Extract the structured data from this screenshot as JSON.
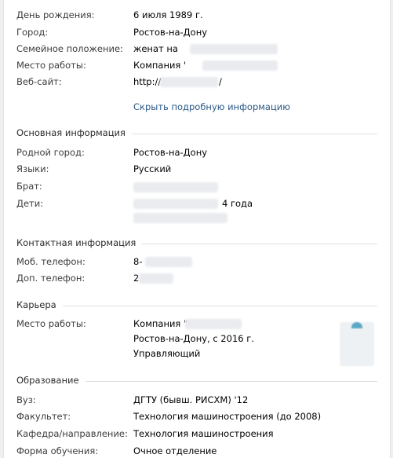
{
  "profile_top": [
    {
      "label": "День рождения:",
      "value": "6 июля 1989 г."
    },
    {
      "label": "Город:",
      "value": "Ростов-на-Дону"
    },
    {
      "label": "Семейное положение:",
      "value": "женат на"
    },
    {
      "label": "Место работы:",
      "value": "Компания '"
    },
    {
      "label": "Веб-сайт:",
      "value": "http://",
      "suffix": "/"
    }
  ],
  "toggle_details": "Скрыть подробную информацию",
  "sections": {
    "basic": {
      "title": "Основная информация",
      "rows": [
        {
          "label": "Родной город:",
          "value": "Ростов-на-Дону"
        },
        {
          "label": "Языки:",
          "value": "Русский"
        },
        {
          "label": "Брат:",
          "value": ""
        },
        {
          "label": "Дети:",
          "value": "",
          "value_suffix": "4 года"
        }
      ]
    },
    "contacts": {
      "title": "Контактная информация",
      "rows": [
        {
          "label": "Моб. телефон:",
          "value": "8-"
        },
        {
          "label": "Доп. телефон:",
          "value": "2"
        }
      ]
    },
    "career": {
      "title": "Карьера",
      "rows": [
        {
          "label": "Место работы:",
          "lines": [
            "Компания \"",
            "Ростов-на-Дону, с 2016 г.",
            "Управляющий"
          ]
        }
      ]
    },
    "education": {
      "title": "Образование",
      "rows": [
        {
          "label": "Вуз:",
          "value": "ДГТУ (бывш. РИСХМ) '12"
        },
        {
          "label": "Факультет:",
          "value": "Технология машиностроения (до 2008)"
        },
        {
          "label": "Кафедра/направление:",
          "value": "Технология машиностроения"
        },
        {
          "label": "Форма обучения:",
          "value": "Очное отделение"
        }
      ]
    }
  }
}
